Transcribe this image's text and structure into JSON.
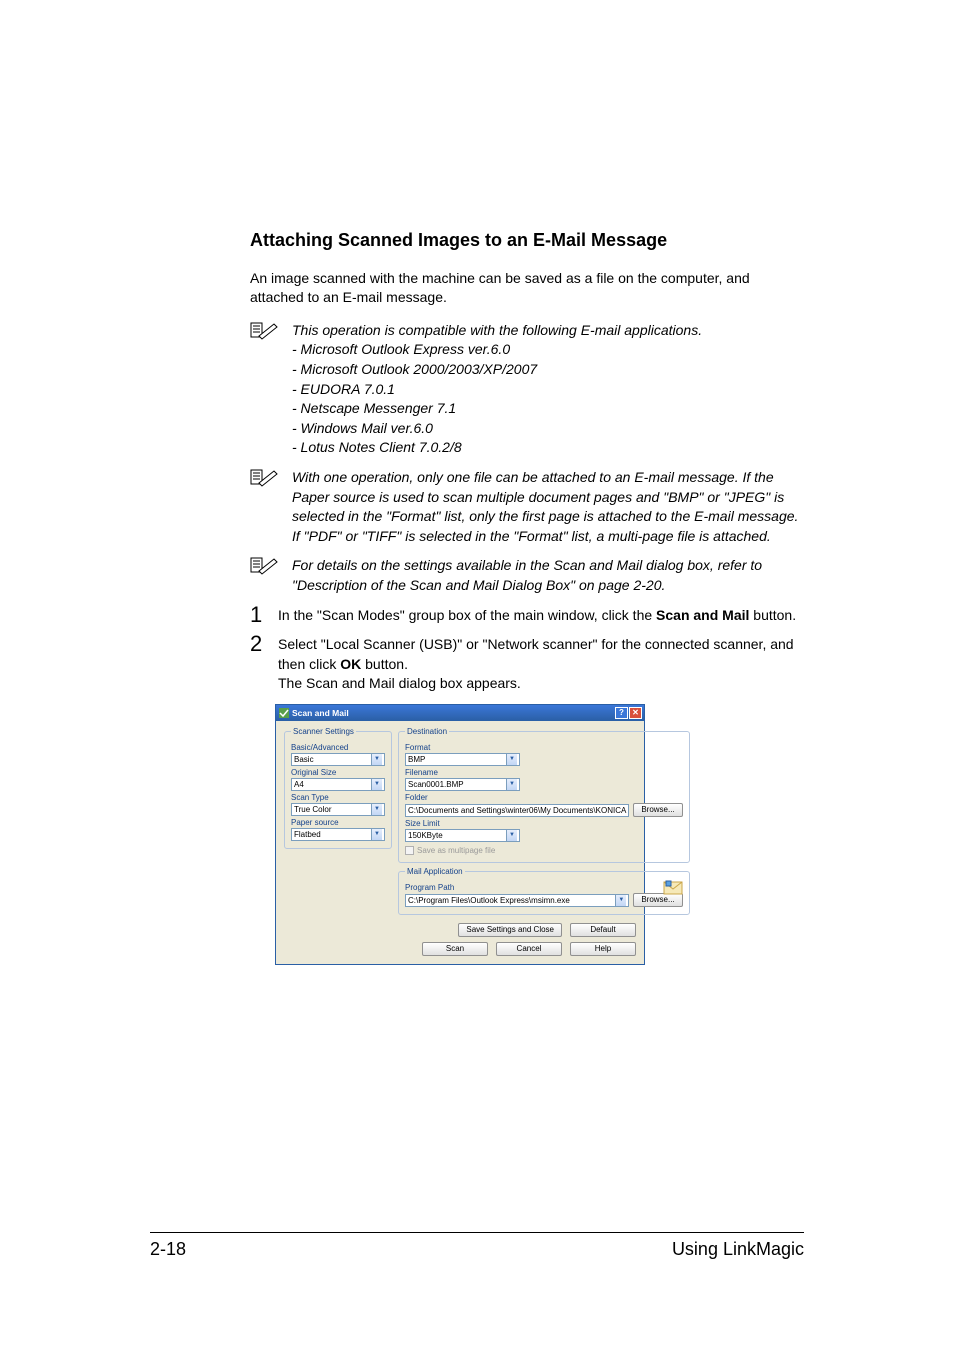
{
  "section_title": "Attaching Scanned Images to an E-Mail Message",
  "intro": "An image scanned with the machine can be saved as a file on the computer, and attached to an E-mail message.",
  "notes": [
    {
      "lines": [
        "This operation is compatible with the following E-mail applications.",
        "- Microsoft Outlook Express ver.6.0",
        "- Microsoft Outlook 2000/2003/XP/2007",
        "- EUDORA 7.0.1",
        "- Netscape Messenger 7.1",
        "- Windows Mail ver.6.0",
        "- Lotus Notes Client 7.0.2/8"
      ]
    },
    {
      "lines": [
        "With one operation, only one file can be attached to an E-mail message. If the Paper source is used to scan multiple document pages and \"BMP\" or \"JPEG\" is selected in the \"Format\" list, only the first page is attached to the E-mail message.",
        "If \"PDF\" or \"TIFF\" is selected in the \"Format\" list, a multi-page file is attached."
      ]
    },
    {
      "lines": [
        "For details on the settings available in the Scan and Mail dialog box, refer to \"Description of the Scan and Mail Dialog Box\" on page 2-20."
      ]
    }
  ],
  "steps": [
    {
      "num": "1",
      "pre": "In the \"Scan Modes\" group box of the main window, click the ",
      "bold": "Scan and Mail",
      "post": " button."
    },
    {
      "num": "2",
      "pre": "Select \"Local Scanner (USB)\" or \"Network scanner\" for the connected scanner, and then click ",
      "bold": "OK",
      "post": " button.",
      "trail": "The Scan and Mail dialog box appears."
    }
  ],
  "dialog": {
    "title": "Scan and Mail",
    "scanner_legend": "Scanner Settings",
    "labels": {
      "basic_adv": "Basic/Advanced",
      "orig_size": "Original Size",
      "scan_type": "Scan Type",
      "paper_source": "Paper source",
      "format": "Format",
      "filename": "Filename",
      "folder": "Folder",
      "size_limit": "Size Limit",
      "program_path": "Program Path"
    },
    "values": {
      "basic_adv": "Basic",
      "orig_size": "A4",
      "scan_type": "True Color",
      "paper_source": "Flatbed",
      "format": "BMP",
      "filename": "Scan0001.BMP",
      "folder": "C:\\Documents and Settings\\winter06\\My Documents\\KONICA",
      "size_limit": "150KByte",
      "program_path": "C:\\Program Files\\Outlook Express\\msimn.exe"
    },
    "destination_legend": "Destination",
    "mail_legend": "Mail Application",
    "save_multipage": "Save as multipage file",
    "buttons": {
      "browse": "Browse...",
      "save_close": "Save Settings and Close",
      "default": "Default",
      "scan": "Scan",
      "cancel": "Cancel",
      "help": "Help"
    }
  },
  "footer": {
    "left": "2-18",
    "right": "Using LinkMagic"
  }
}
